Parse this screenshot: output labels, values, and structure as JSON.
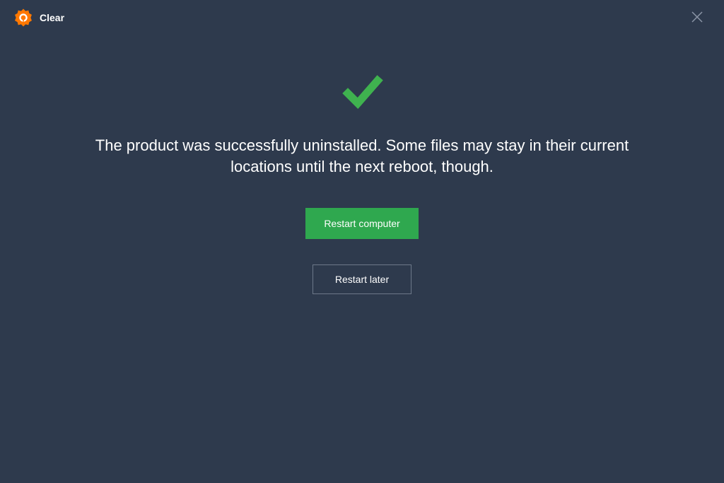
{
  "header": {
    "app_title": "Clear"
  },
  "main": {
    "message": "The product was successfully uninstalled. Some files may stay in their current locations until the next reboot, though.",
    "primary_button_label": "Restart computer",
    "secondary_button_label": "Restart later"
  },
  "colors": {
    "background": "#2e3a4d",
    "accent": "#2fa84f",
    "logo": "#ff7800"
  }
}
